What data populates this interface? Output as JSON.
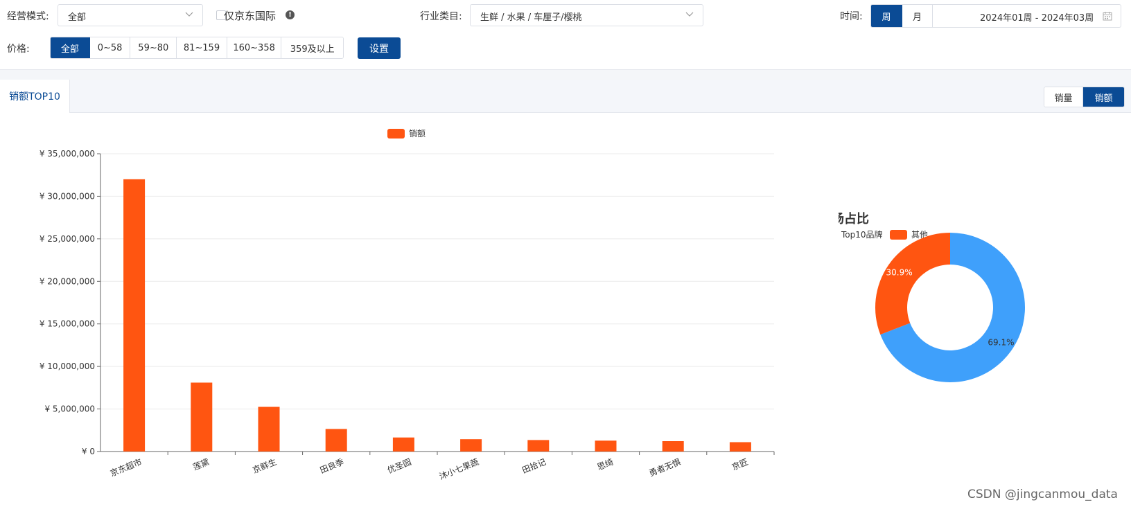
{
  "filters": {
    "mode_label": "经营模式:",
    "mode_value": "全部",
    "jd_intl_label": "仅京东国际",
    "industry_label": "行业类目:",
    "industry_value": "生鲜 / 水果 / 车厘子/樱桃",
    "time_label": "时间:",
    "time_units": [
      {
        "label": "周",
        "active": true
      },
      {
        "label": "月",
        "active": false
      }
    ],
    "date_range": "2024年01周 - 2024年03周",
    "price_label": "价格:",
    "price_options": [
      {
        "label": "全部",
        "active": true
      },
      {
        "label": "0~58",
        "active": false
      },
      {
        "label": "59~80",
        "active": false
      },
      {
        "label": "81~159",
        "active": false
      },
      {
        "label": "160~358",
        "active": false
      },
      {
        "label": "359及以上",
        "active": false
      }
    ],
    "settings_button": "设置"
  },
  "tabs": {
    "active_tab": "销额TOP10",
    "metric_toggle": [
      {
        "label": "销量",
        "active": false
      },
      {
        "label": "销额",
        "active": true
      }
    ]
  },
  "colors": {
    "primary": "#0b4b95",
    "bar": "#ff5511",
    "top10": "#3fa0fb",
    "other": "#ff5511"
  },
  "chart_data": [
    {
      "type": "bar",
      "legend": [
        "销额"
      ],
      "legend_position": "top-center",
      "categories": [
        "京东超市",
        "莲黛",
        "京鲜生",
        "田良季",
        "优圣园",
        "沐小七果蔬",
        "田拾记",
        "思绮",
        "勇者无惧",
        "京匠"
      ],
      "series": [
        {
          "name": "销额",
          "values": [
            32000000,
            8100000,
            5250000,
            2650000,
            1650000,
            1450000,
            1350000,
            1280000,
            1220000,
            1100000
          ]
        }
      ],
      "y_ticks": [
        "¥ 0",
        "¥ 5,000,000",
        "¥ 10,000,000",
        "¥ 15,000,000",
        "¥ 20,000,000",
        "¥ 25,000,000",
        "¥ 30,000,000",
        "¥ 35,000,000"
      ],
      "ylim": [
        0,
        35000000
      ],
      "grid": true
    },
    {
      "type": "pie",
      "title": "市场占比",
      "legend": [
        "Top10品牌",
        "其他"
      ],
      "legend_position": "top-left",
      "slices": [
        {
          "name": "Top10品牌",
          "value": 69.1,
          "label": "69.1%"
        },
        {
          "name": "其他",
          "value": 30.9,
          "label": "30.9%"
        }
      ]
    }
  ],
  "watermark": "CSDN @jingcanmou_data"
}
